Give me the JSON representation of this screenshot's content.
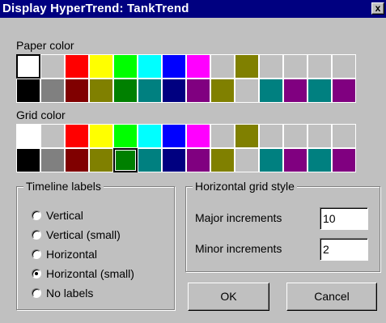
{
  "window": {
    "title": "Display HyperTrend: TankTrend",
    "close_glyph": "x"
  },
  "paper": {
    "label": "Paper color",
    "colors": [
      "#ffffff",
      "#c0c0c0",
      "#ff0000",
      "#ffff00",
      "#00ff00",
      "#00ffff",
      "#0000ff",
      "#ff00ff",
      "#c0c0c0",
      "#808000",
      "#c0c0c0",
      "#c0c0c0",
      "#c0c0c0",
      "#c0c0c0",
      "#000000",
      "#808080",
      "#800000",
      "#808000",
      "#008000",
      "#008080",
      "#000080",
      "#800080",
      "#808000",
      "#c0c0c0",
      "#008080",
      "#800080",
      "#008080",
      "#800080"
    ],
    "selected": 0
  },
  "grid": {
    "label": "Grid color",
    "colors": [
      "#ffffff",
      "#c0c0c0",
      "#ff0000",
      "#ffff00",
      "#00ff00",
      "#00ffff",
      "#0000ff",
      "#ff00ff",
      "#c0c0c0",
      "#808000",
      "#c0c0c0",
      "#c0c0c0",
      "#c0c0c0",
      "#c0c0c0",
      "#000000",
      "#808080",
      "#800000",
      "#808000",
      "#008000",
      "#008080",
      "#000080",
      "#800080",
      "#808000",
      "#c0c0c0",
      "#008080",
      "#800080",
      "#008080",
      "#800080"
    ],
    "selected": 18
  },
  "timeline": {
    "title": "Timeline labels",
    "options": [
      {
        "label": "Vertical",
        "checked": false
      },
      {
        "label": "Vertical (small)",
        "checked": false
      },
      {
        "label": "Horizontal",
        "checked": false
      },
      {
        "label": "Horizontal (small)",
        "checked": true
      },
      {
        "label": "No labels",
        "checked": false
      }
    ]
  },
  "hgrid": {
    "title": "Horizontal grid style",
    "major_label": "Major increments",
    "major_value": "10",
    "minor_label": "Minor increments",
    "minor_value": "2"
  },
  "buttons": {
    "ok": "OK",
    "cancel": "Cancel"
  }
}
